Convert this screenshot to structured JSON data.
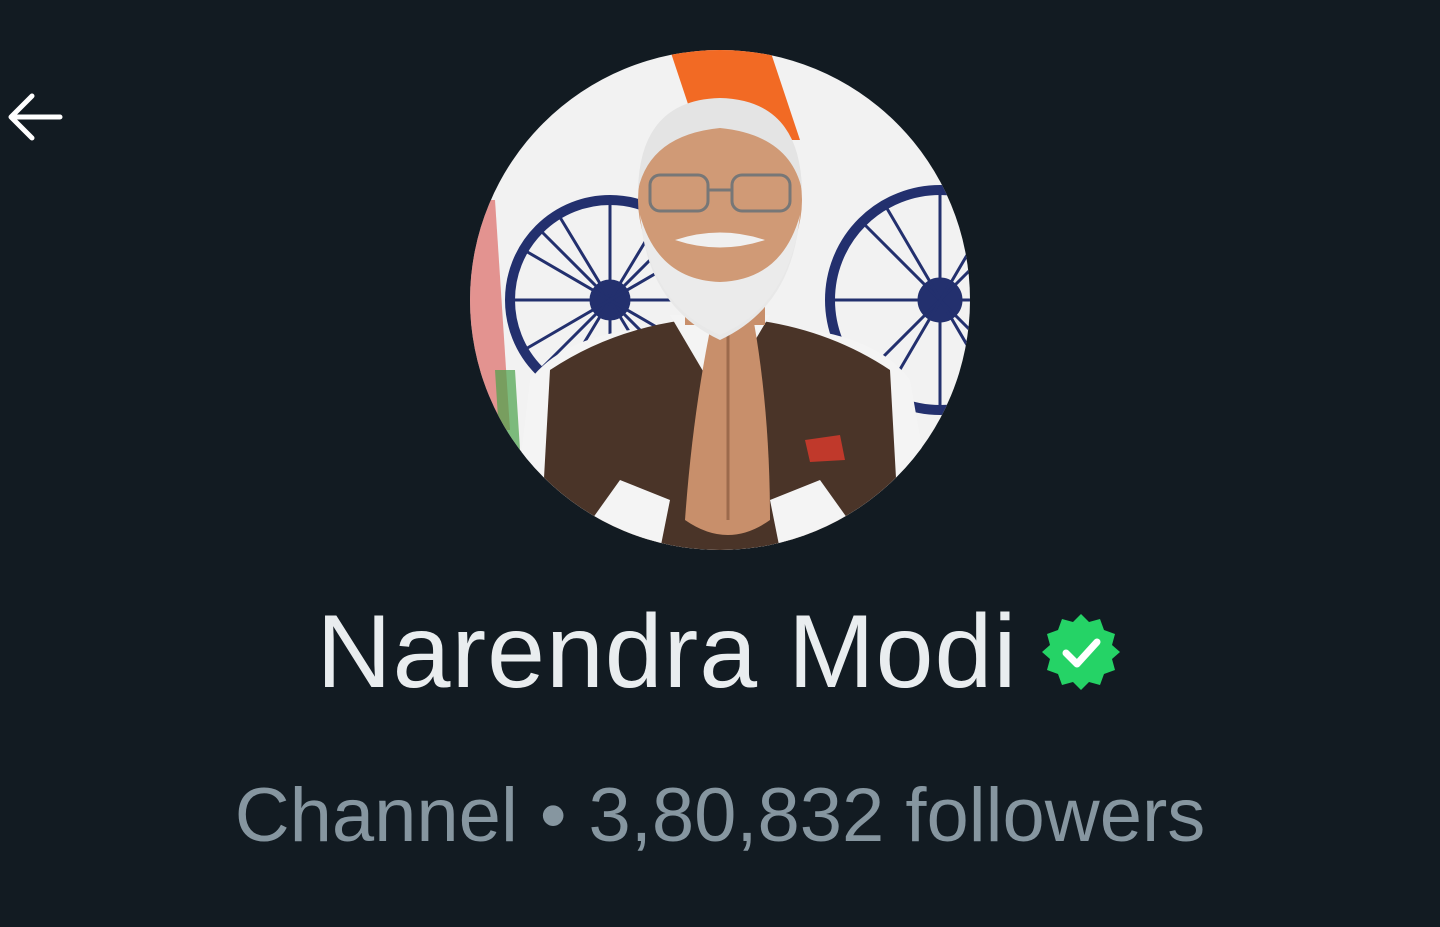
{
  "header": {
    "back_icon": "arrow-left-icon"
  },
  "profile": {
    "avatar_icon": "profile-photo",
    "name": "Narendra Modi",
    "verified_icon": "verified-badge-icon",
    "type_label": "Channel",
    "separator": "•",
    "followers": "3,80,832 followers"
  },
  "colors": {
    "background": "#121b22",
    "name_text": "#e9edef",
    "subtitle_text": "#8696a0",
    "verified_green": "#25d366"
  }
}
